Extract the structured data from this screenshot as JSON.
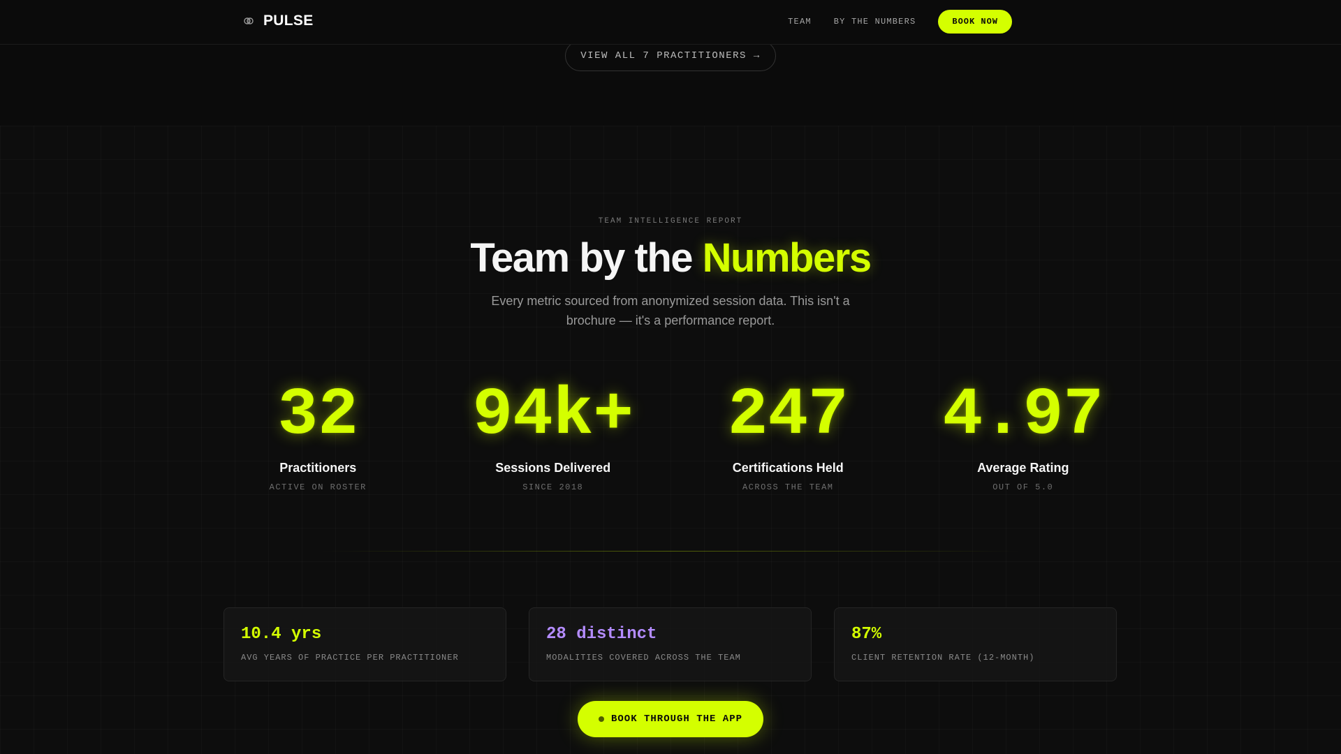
{
  "nav": {
    "brand": "PULSE",
    "links": [
      "TEAM",
      "BY THE NUMBERS"
    ],
    "cta": "BOOK NOW"
  },
  "view_all": "VIEW ALL 7 PRACTITIONERS →",
  "hero": {
    "eyebrow": "TEAM INTELLIGENCE REPORT",
    "title_prefix": "Team by the ",
    "title_accent": "Numbers",
    "subtitle": "Every metric sourced from anonymized session data. This isn't a brochure — it's a performance report."
  },
  "stats": [
    {
      "value": "32",
      "label": "Practitioners",
      "sub": "ACTIVE ON ROSTER"
    },
    {
      "value": "94k+",
      "label": "Sessions Delivered",
      "sub": "SINCE 2018"
    },
    {
      "value": "247",
      "label": "Certifications Held",
      "sub": "ACROSS THE TEAM"
    },
    {
      "value": "4.97",
      "label": "Average Rating",
      "sub": "OUT OF 5.0"
    }
  ],
  "cards": [
    {
      "value": "10.4 yrs",
      "label": "AVG YEARS OF PRACTICE PER PRACTITIONER"
    },
    {
      "value": "28 distinct",
      "label": "MODALITIES COVERED ACROSS THE TEAM"
    },
    {
      "value": "87%",
      "label": "CLIENT RETENTION RATE (12-MONTH)"
    }
  ],
  "cta": "BOOK THROUGH THE APP",
  "colors": {
    "accent": "#d4ff00",
    "purple": "#b48cff",
    "background": "#0b0b0b"
  },
  "icons": {
    "logo": "brain-icon",
    "cta": "dot-icon"
  }
}
